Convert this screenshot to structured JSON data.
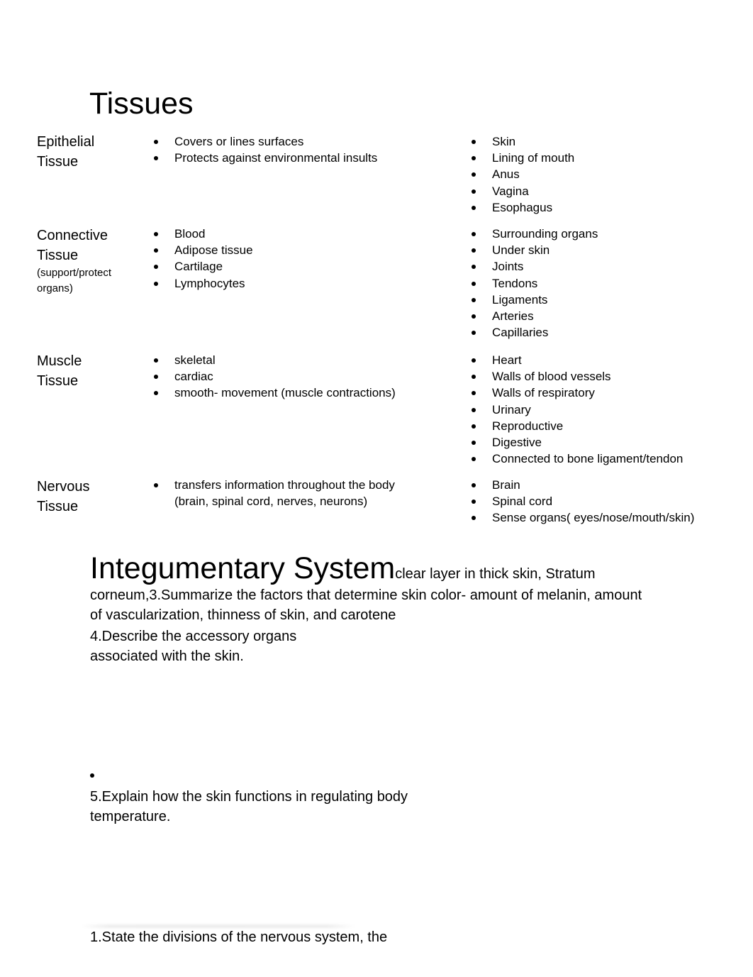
{
  "tissues": {
    "title": "Tissues",
    "rows": [
      {
        "label_line1": "Epithelial",
        "label_line2": "Tissue",
        "sublabel": null,
        "types": [
          "Covers or lines surfaces",
          "Protects against environmental insults"
        ],
        "locations": [
          "Skin",
          "Lining of mouth",
          "Anus",
          "Vagina",
          "Esophagus"
        ]
      },
      {
        "label_line1": "Connective",
        "label_line2": "Tissue",
        "sublabel": "(support/protect organs)",
        "types": [
          "Blood",
          "Adipose tissue",
          "Cartilage",
          "Lymphocytes"
        ],
        "locations": [
          "Surrounding organs",
          "Under skin",
          "Joints",
          "Tendons",
          "Ligaments",
          "Arteries",
          "Capillaries"
        ]
      },
      {
        "label_line1": "Muscle",
        "label_line2": "Tissue",
        "sublabel": null,
        "types": [
          "skeletal",
          "cardiac",
          "smooth- movement (muscle contractions)"
        ],
        "locations": [
          "Heart",
          "Walls of blood vessels",
          "Walls of respiratory",
          "Urinary",
          "Reproductive",
          "Digestive",
          "Connected to bone ligament/tendon"
        ]
      },
      {
        "label_line1": "Nervous",
        "label_line2": "Tissue",
        "sublabel": null,
        "types": [
          "transfers information throughout the body (brain, spinal cord, nerves, neurons)"
        ],
        "locations": [
          "Brain",
          "Spinal cord",
          "Sense organs( eyes/nose/mouth/skin)"
        ]
      }
    ]
  },
  "integumentary": {
    "title": "Integumentary System",
    "inline_text": "clear layer in thick skin, Stratum corneum,3.Summarize the factors that determine skin color- amount of melanin, amount of vascularization, thinness of skin, and carotene",
    "q4_line1": "4.Describe the accessory organs",
    "q4_line2": "associated with the skin.",
    "q5_line1": "5.Explain how the skin functions in regulating body",
    "q5_line2": "temperature."
  },
  "nervous_section": {
    "q1": "1.State the divisions of the nervous system, the"
  }
}
